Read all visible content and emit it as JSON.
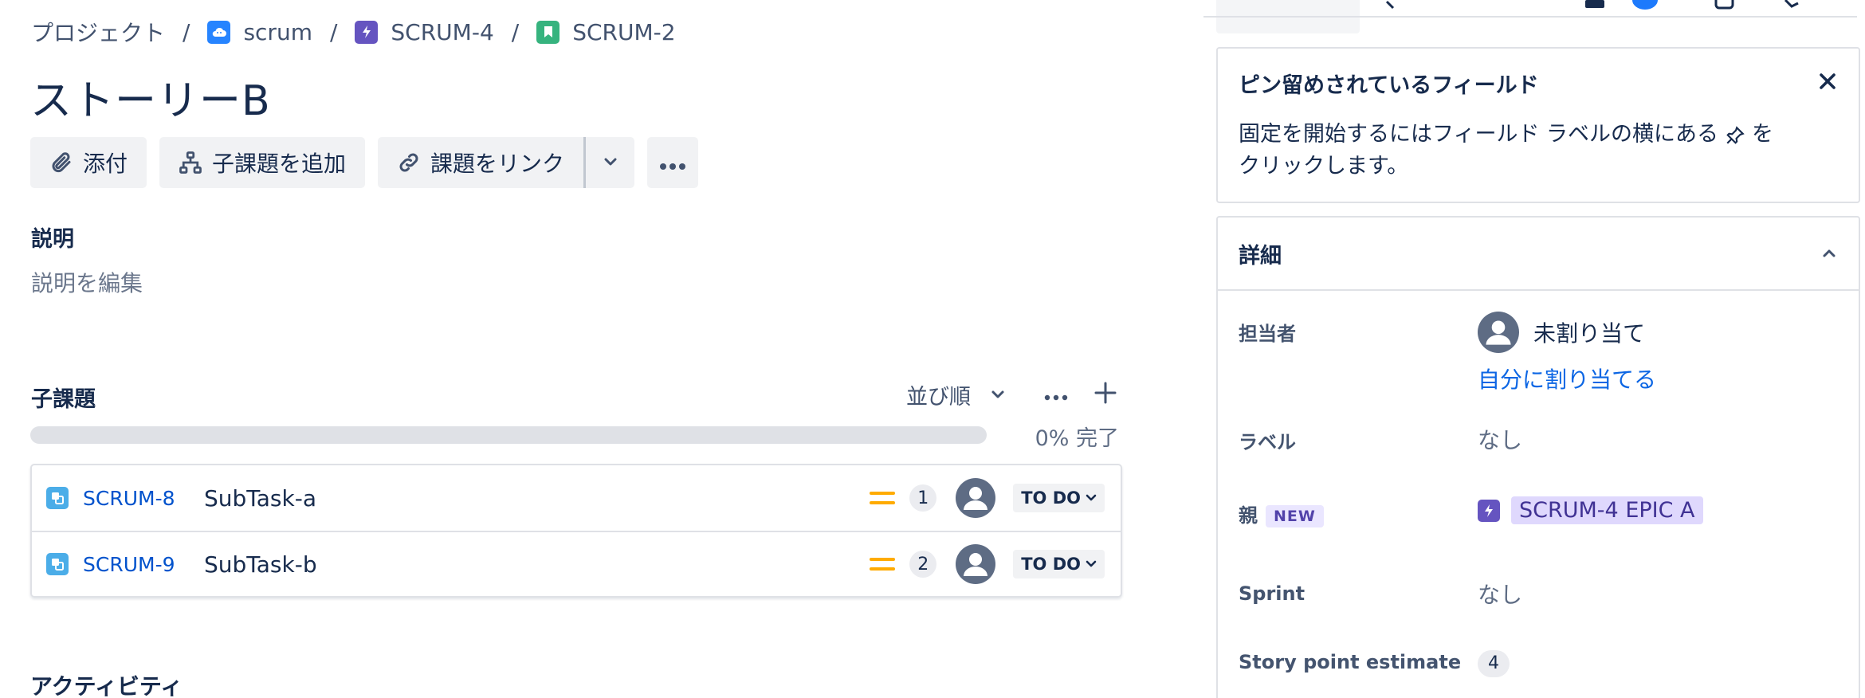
{
  "breadcrumb": {
    "root": "プロジェクト",
    "project": "scrum",
    "epic": "SCRUM-4",
    "issue": "SCRUM-2",
    "separator": "/"
  },
  "issue": {
    "title": "ストーリーB"
  },
  "toolbar": {
    "attach": "添付",
    "add_child": "子課題を追加",
    "link_issue": "課題をリンク"
  },
  "description": {
    "heading": "説明",
    "placeholder": "説明を編集"
  },
  "subtasks": {
    "heading": "子課題",
    "sort_label": "並び順",
    "progress_percent": 0,
    "progress_label": "0% 完了",
    "items": [
      {
        "key": "SCRUM-8",
        "summary": "SubTask-a",
        "priority": "medium",
        "points": "1",
        "status": "TO DO"
      },
      {
        "key": "SCRUM-9",
        "summary": "SubTask-b",
        "priority": "medium",
        "points": "2",
        "status": "TO DO"
      }
    ]
  },
  "activity": {
    "heading": "アクティビティ"
  },
  "pinned": {
    "title": "ピン留めされているフィールド",
    "body_before": "固定を開始するにはフィールド ラベルの横にある",
    "body_after": "を",
    "body_line2": "クリックします。"
  },
  "details": {
    "heading": "詳細",
    "assignee_label": "担当者",
    "assignee_value": "未割り当て",
    "assign_to_me": "自分に割り当てる",
    "labels_label": "ラベル",
    "labels_value": "なし",
    "parent_label": "親",
    "parent_badge": "NEW",
    "parent_value": "SCRUM-4 EPIC A",
    "sprint_label": "Sprint",
    "sprint_value": "なし",
    "story_points_label": "Story point estimate",
    "story_points_value": "4"
  },
  "colors": {
    "link": "#0052cc",
    "epic": "#6554c0",
    "story": "#36b37e",
    "subtask": "#4bade8",
    "priority_medium": "#ffab00",
    "project": "#2684ff"
  }
}
